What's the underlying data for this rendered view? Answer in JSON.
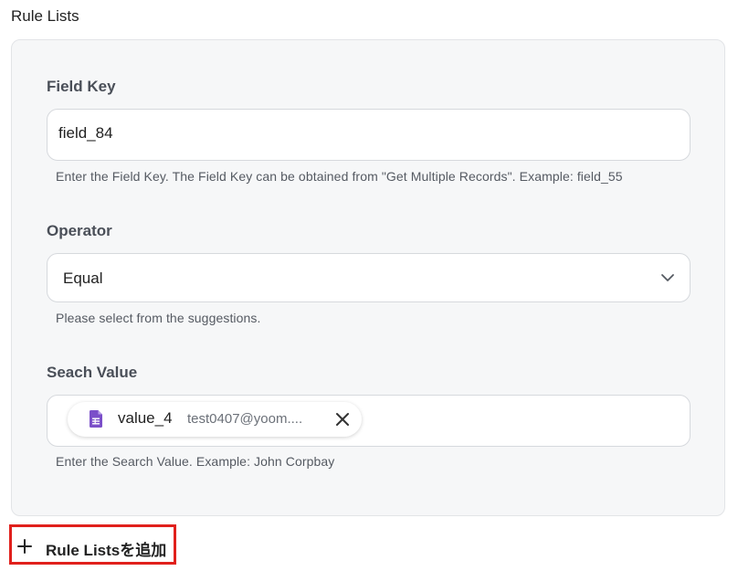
{
  "section": {
    "title": "Rule Lists"
  },
  "field_key": {
    "label": "Field Key",
    "value": "field_84",
    "hint": "Enter the Field Key. The Field Key can be obtained from \"Get Multiple Records\". Example: field_55"
  },
  "operator": {
    "label": "Operator",
    "selected": "Equal",
    "hint": "Please select from the suggestions."
  },
  "search_value": {
    "label": "Seach Value",
    "chip": {
      "name": "value_4",
      "value": "test0407@yoom....",
      "icon": "google-sheets-icon"
    },
    "hint": "Enter the Search Value. Example: John Corpbay"
  },
  "add_button": {
    "label": "Rule Listsを追加"
  },
  "colors": {
    "accent_red": "#e0201c",
    "sheet_purple": "#7b4fc9",
    "panel_bg": "#f6f7f8"
  }
}
